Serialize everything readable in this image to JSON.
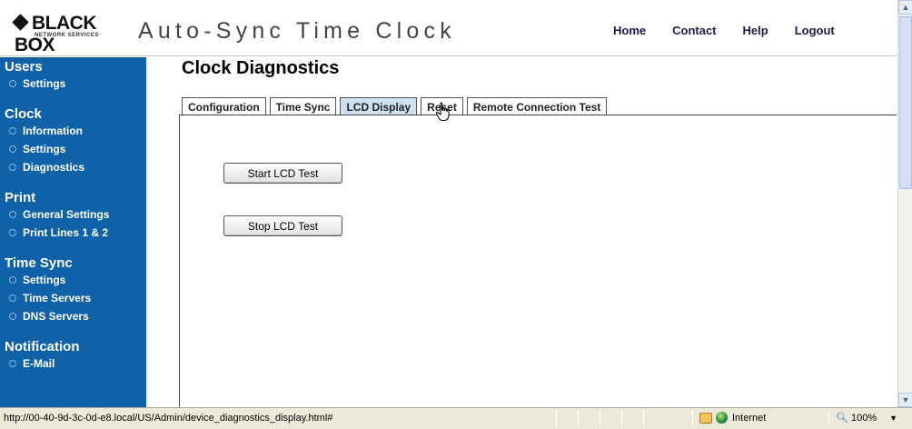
{
  "header": {
    "logo_main": "BLACK BOX",
    "logo_sub": "NETWORK SERVICES",
    "app_title": "Auto-Sync Time Clock",
    "nav": [
      "Home",
      "Contact",
      "Help",
      "Logout"
    ]
  },
  "sidebar": {
    "sections": [
      {
        "heading": "Users",
        "items": [
          "Settings"
        ]
      },
      {
        "heading": "Clock",
        "items": [
          "Information",
          "Settings",
          "Diagnostics"
        ]
      },
      {
        "heading": "Print",
        "items": [
          "General Settings",
          "Print Lines 1 & 2"
        ]
      },
      {
        "heading": "Time Sync",
        "items": [
          "Settings",
          "Time Servers",
          "DNS Servers"
        ]
      },
      {
        "heading": "Notification",
        "items": [
          "E-Mail"
        ]
      }
    ],
    "bg_color": "#0f62a8"
  },
  "main": {
    "title": "Clock Diagnostics",
    "tabs": [
      {
        "label": "Configuration",
        "active": false
      },
      {
        "label": "Time Sync",
        "active": false
      },
      {
        "label": "LCD Display",
        "active": true
      },
      {
        "label": "Reset",
        "active": false
      },
      {
        "label": "Remote Connection Test",
        "active": false
      }
    ],
    "buttons": {
      "start": "Start LCD Test",
      "stop": "Stop LCD Test"
    }
  },
  "statusbar": {
    "url": "http://00-40-9d-3c-0d-e8.local/US/Admin/device_diagnostics_display.html#",
    "zone": "Internet",
    "zoom": "100%"
  },
  "icons": {
    "cursor": "hand-pointer-icon",
    "bullet": "circle-bullet-icon",
    "zone": "globe-icon",
    "protected": "lock-icon",
    "zoom": "magnifier-icon"
  }
}
